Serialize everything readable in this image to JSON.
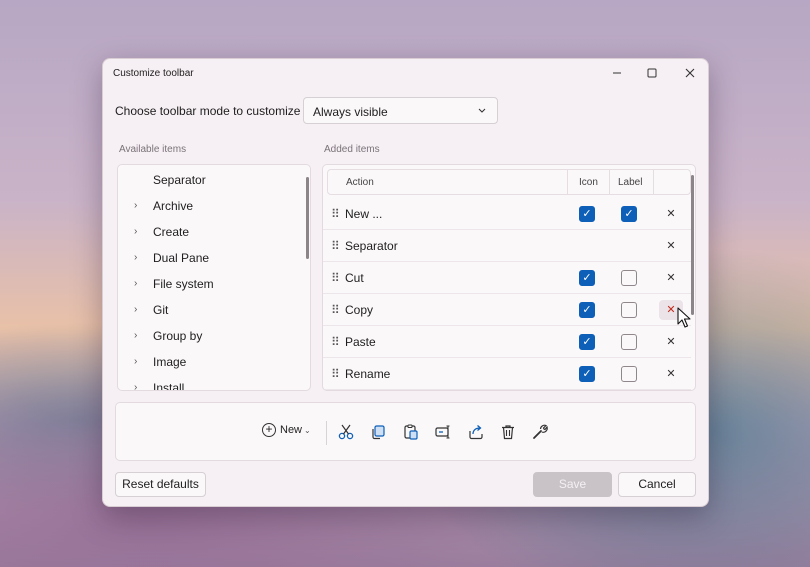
{
  "window": {
    "title": "Customize toolbar",
    "minimize_icon": "minimize-icon",
    "maximize_icon": "maximize-icon",
    "close_icon": "close-icon"
  },
  "mode": {
    "label": "Choose toolbar mode to customize",
    "selected": "Always visible",
    "chevron": "chevron-down-icon"
  },
  "available": {
    "label": "Available items",
    "items": [
      {
        "label": "Separator",
        "expandable": false
      },
      {
        "label": "Archive",
        "expandable": true
      },
      {
        "label": "Create",
        "expandable": true
      },
      {
        "label": "Dual Pane",
        "expandable": true
      },
      {
        "label": "File system",
        "expandable": true
      },
      {
        "label": "Git",
        "expandable": true
      },
      {
        "label": "Group by",
        "expandable": true
      },
      {
        "label": "Image",
        "expandable": true
      },
      {
        "label": "Install",
        "expandable": true
      }
    ]
  },
  "added": {
    "label": "Added items",
    "columns": {
      "action": "Action",
      "icon": "Icon",
      "label": "Label"
    },
    "rows": [
      {
        "name": "New ...",
        "icon": true,
        "label": true
      },
      {
        "name": "Separator",
        "icon": null,
        "label": null
      },
      {
        "name": "Cut",
        "icon": true,
        "label": false
      },
      {
        "name": "Copy",
        "icon": true,
        "label": false
      },
      {
        "name": "Paste",
        "icon": true,
        "label": false
      },
      {
        "name": "Rename",
        "icon": true,
        "label": false
      }
    ]
  },
  "preview": {
    "new_label": "New",
    "icons": [
      "cut-icon",
      "copy-icon",
      "paste-icon",
      "rename-icon",
      "share-icon",
      "delete-icon",
      "properties-icon"
    ]
  },
  "buttons": {
    "reset": "Reset defaults",
    "save": "Save",
    "cancel": "Cancel"
  },
  "colors": {
    "accent": "#0d5fb8",
    "remove_hover": "#c42b1c"
  }
}
